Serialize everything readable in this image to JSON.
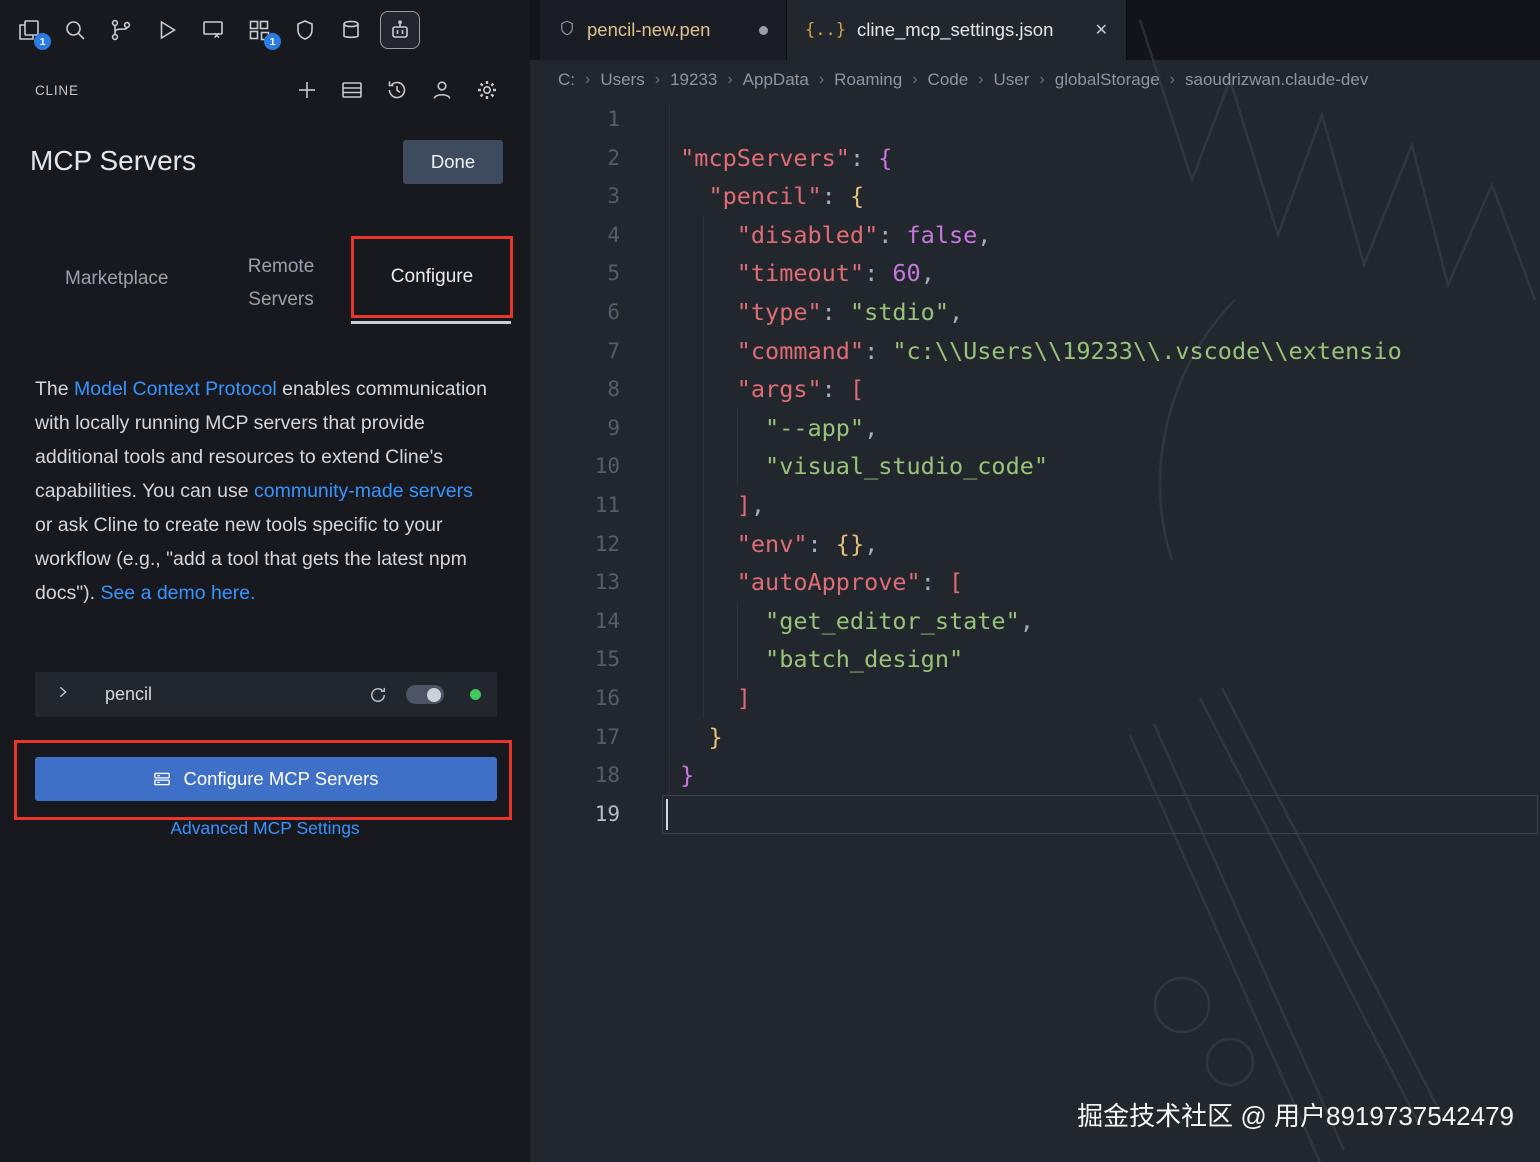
{
  "activity_bar": {
    "icons": [
      {
        "name": "copy-files-icon",
        "badge": "1"
      },
      {
        "name": "search-icon"
      },
      {
        "name": "source-control-icon"
      },
      {
        "name": "run-debug-icon"
      },
      {
        "name": "remote-window-icon"
      },
      {
        "name": "extensions-icon",
        "badge": "1"
      },
      {
        "name": "shield-icon"
      },
      {
        "name": "database-icon"
      },
      {
        "name": "cline-robot-icon",
        "active": true
      }
    ]
  },
  "sidebar": {
    "view_title": "CLINE",
    "page_title": "MCP Servers",
    "done_button": "Done",
    "tabs": {
      "marketplace": "Marketplace",
      "remote_line1": "Remote",
      "remote_line2": "Servers",
      "configure": "Configure"
    },
    "description": [
      {
        "text": "The "
      },
      {
        "text": "Model Context Protocol",
        "link": true
      },
      {
        "text": " enables communication with locally running MCP servers that provide additional tools and resources to extend Cline's capabilities. You can use "
      },
      {
        "text": "community-made servers",
        "link": true
      },
      {
        "text": " or ask Cline to create new tools specific to your workflow (e.g., \"add a tool that gets the latest npm docs\"). "
      },
      {
        "text": "See a demo here.",
        "link": true
      }
    ],
    "server_row": {
      "name": "pencil"
    },
    "configure_button": "Configure MCP Servers",
    "advanced_link": "Advanced MCP Settings"
  },
  "editor": {
    "tabs": [
      {
        "label": "pencil-new.pen",
        "modified": true
      },
      {
        "label": "cline_mcp_settings.json",
        "active": true
      }
    ],
    "breadcrumbs": [
      "C:",
      "Users",
      "19233",
      "AppData",
      "Roaming",
      "Code",
      "User",
      "globalStorage",
      "saoudrizwan.claude-dev"
    ],
    "active_line": 19,
    "code_lines": [
      {
        "n": 1,
        "tokens": []
      },
      {
        "n": 2,
        "tokens": [
          [
            "pn",
            " "
          ],
          [
            "key",
            "\"mcpServers\""
          ],
          [
            "pn",
            ": "
          ],
          [
            "bm",
            "{"
          ]
        ]
      },
      {
        "n": 3,
        "tokens": [
          [
            "pn",
            "   "
          ],
          [
            "key",
            "\"pencil\""
          ],
          [
            "pn",
            ": "
          ],
          [
            "by",
            "{"
          ]
        ]
      },
      {
        "n": 4,
        "tokens": [
          [
            "pn",
            "     "
          ],
          [
            "key",
            "\"disabled\""
          ],
          [
            "pn",
            ": "
          ],
          [
            "kw",
            "false"
          ],
          [
            "pn",
            ","
          ]
        ]
      },
      {
        "n": 5,
        "tokens": [
          [
            "pn",
            "     "
          ],
          [
            "key",
            "\"timeout\""
          ],
          [
            "pn",
            ": "
          ],
          [
            "num",
            "60"
          ],
          [
            "pn",
            ","
          ]
        ]
      },
      {
        "n": 6,
        "tokens": [
          [
            "pn",
            "     "
          ],
          [
            "key",
            "\"type\""
          ],
          [
            "pn",
            ": "
          ],
          [
            "str",
            "\"stdio\""
          ],
          [
            "pn",
            ","
          ]
        ]
      },
      {
        "n": 7,
        "tokens": [
          [
            "pn",
            "     "
          ],
          [
            "key",
            "\"command\""
          ],
          [
            "pn",
            ": "
          ],
          [
            "str",
            "\"c:\\\\Users\\\\19233\\\\.vscode\\\\extensio"
          ]
        ]
      },
      {
        "n": 8,
        "tokens": [
          [
            "pn",
            "     "
          ],
          [
            "key",
            "\"args\""
          ],
          [
            "pn",
            ": "
          ],
          [
            "br",
            "["
          ]
        ]
      },
      {
        "n": 9,
        "tokens": [
          [
            "pn",
            "       "
          ],
          [
            "str",
            "\"--app\""
          ],
          [
            "pn",
            ","
          ]
        ]
      },
      {
        "n": 10,
        "tokens": [
          [
            "pn",
            "       "
          ],
          [
            "str",
            "\"visual_studio_code\""
          ]
        ]
      },
      {
        "n": 11,
        "tokens": [
          [
            "pn",
            "     "
          ],
          [
            "br",
            "]"
          ],
          [
            "pn",
            ","
          ]
        ]
      },
      {
        "n": 12,
        "tokens": [
          [
            "pn",
            "     "
          ],
          [
            "key",
            "\"env\""
          ],
          [
            "pn",
            ": "
          ],
          [
            "by",
            "{}"
          ],
          [
            "pn",
            ","
          ]
        ]
      },
      {
        "n": 13,
        "tokens": [
          [
            "pn",
            "     "
          ],
          [
            "key",
            "\"autoApprove\""
          ],
          [
            "pn",
            ": "
          ],
          [
            "br",
            "["
          ]
        ]
      },
      {
        "n": 14,
        "tokens": [
          [
            "pn",
            "       "
          ],
          [
            "str",
            "\"get_editor_state\""
          ],
          [
            "pn",
            ","
          ]
        ]
      },
      {
        "n": 15,
        "tokens": [
          [
            "pn",
            "       "
          ],
          [
            "str",
            "\"batch_design\""
          ]
        ]
      },
      {
        "n": 16,
        "tokens": [
          [
            "pn",
            "     "
          ],
          [
            "br",
            "]"
          ]
        ]
      },
      {
        "n": 17,
        "tokens": [
          [
            "pn",
            "   "
          ],
          [
            "by",
            "}"
          ]
        ]
      },
      {
        "n": 18,
        "tokens": [
          [
            "pn",
            " "
          ],
          [
            "bm",
            "}"
          ]
        ]
      },
      {
        "n": 19,
        "tokens": []
      }
    ]
  },
  "watermark": "掘金技术社区 @ 用户8919737542479",
  "colors": {
    "annotation": "#e8362b",
    "accent": "#3f70c8",
    "link": "#3794ff",
    "key": "#e06c75",
    "string": "#98c379",
    "keyword": "#c678dd",
    "bracket_red": "#e06c75",
    "bracket_yellow": "#e5c07b",
    "bracket_magenta": "#c678dd",
    "modified_tab": "#e2c08d",
    "status_green": "#41c85c"
  }
}
